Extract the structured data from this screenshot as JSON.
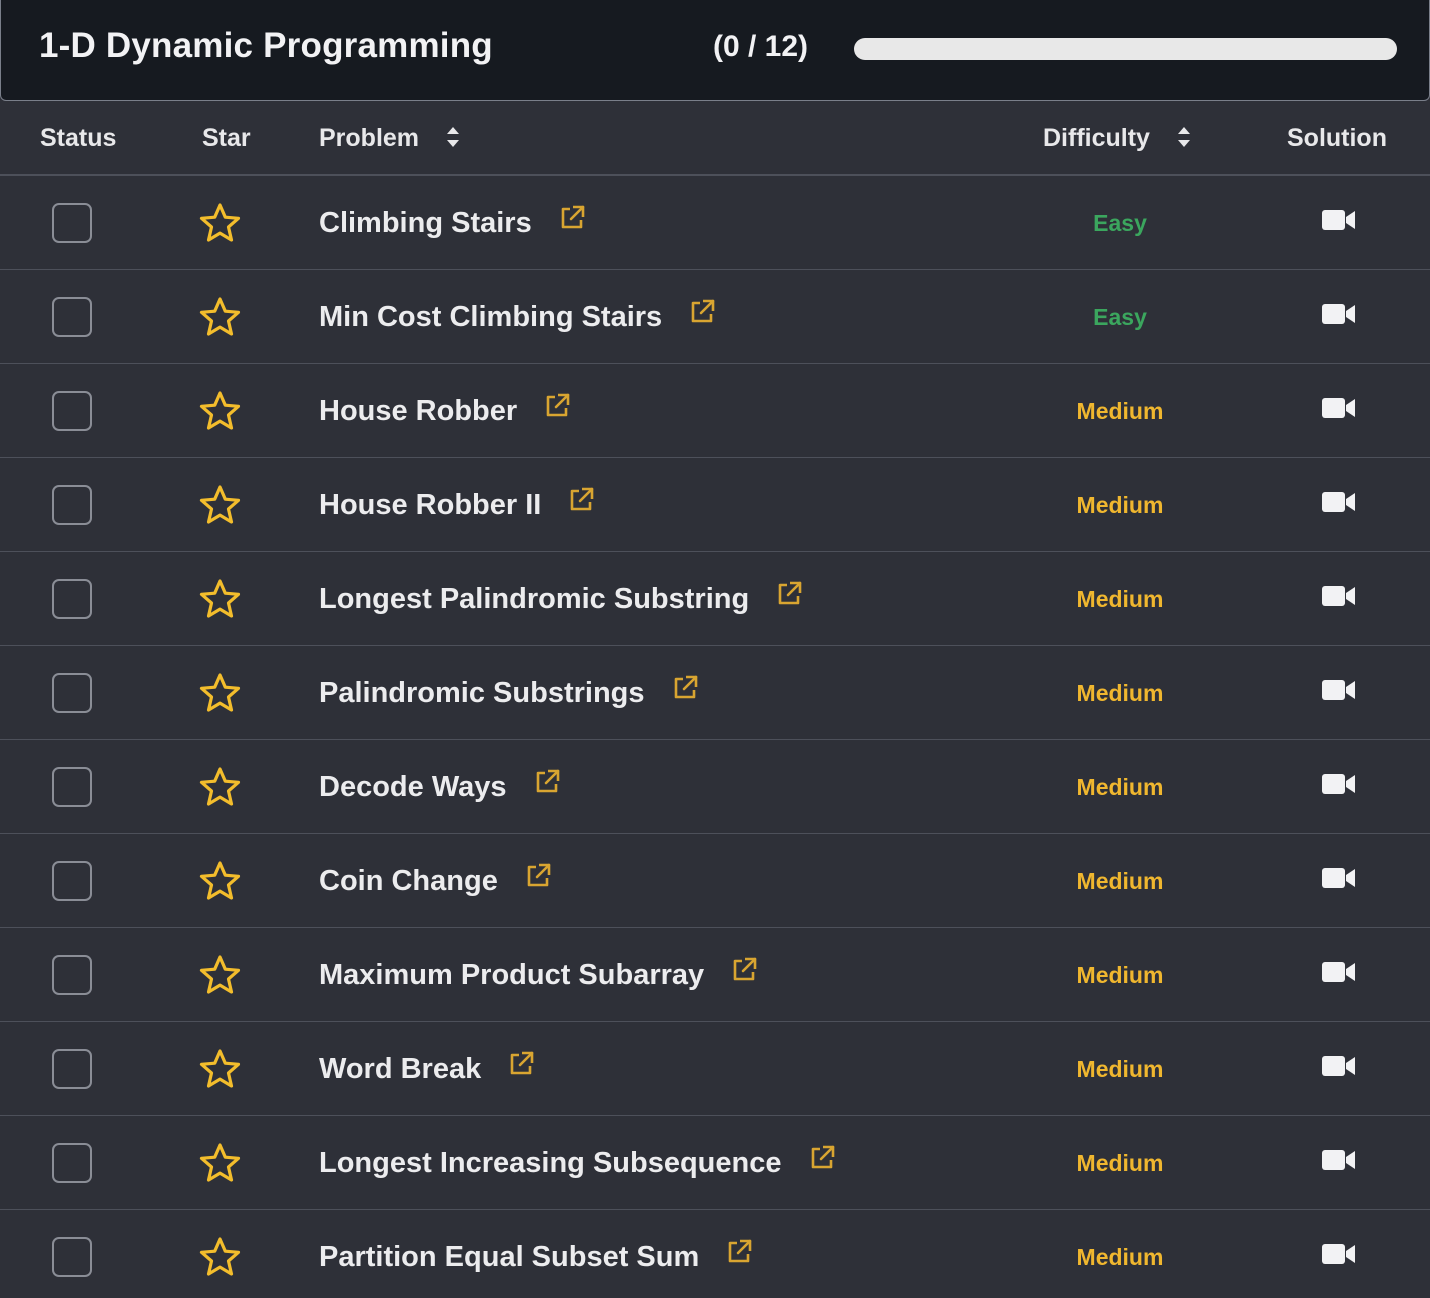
{
  "header": {
    "title": "1-D Dynamic Programming",
    "progress_text": "(0 / 12)",
    "progress_completed": 0,
    "progress_total": 12
  },
  "columns": {
    "status": "Status",
    "star": "Star",
    "problem": "Problem",
    "difficulty": "Difficulty",
    "solution": "Solution"
  },
  "colors": {
    "easy": "#3ba65e",
    "medium": "#f0b72f",
    "link_icon": "#d9a531",
    "star_icon": "#f3bd2c"
  },
  "problems": [
    {
      "name": "Climbing Stairs",
      "difficulty": "Easy",
      "level": "easy"
    },
    {
      "name": "Min Cost Climbing Stairs",
      "difficulty": "Easy",
      "level": "easy"
    },
    {
      "name": "House Robber",
      "difficulty": "Medium",
      "level": "medium"
    },
    {
      "name": "House Robber II",
      "difficulty": "Medium",
      "level": "medium"
    },
    {
      "name": "Longest Palindromic Substring",
      "difficulty": "Medium",
      "level": "medium"
    },
    {
      "name": "Palindromic Substrings",
      "difficulty": "Medium",
      "level": "medium"
    },
    {
      "name": "Decode Ways",
      "difficulty": "Medium",
      "level": "medium"
    },
    {
      "name": "Coin Change",
      "difficulty": "Medium",
      "level": "medium"
    },
    {
      "name": "Maximum Product Subarray",
      "difficulty": "Medium",
      "level": "medium"
    },
    {
      "name": "Word Break",
      "difficulty": "Medium",
      "level": "medium"
    },
    {
      "name": "Longest Increasing Subsequence",
      "difficulty": "Medium",
      "level": "medium"
    },
    {
      "name": "Partition Equal Subset Sum",
      "difficulty": "Medium",
      "level": "medium"
    }
  ]
}
